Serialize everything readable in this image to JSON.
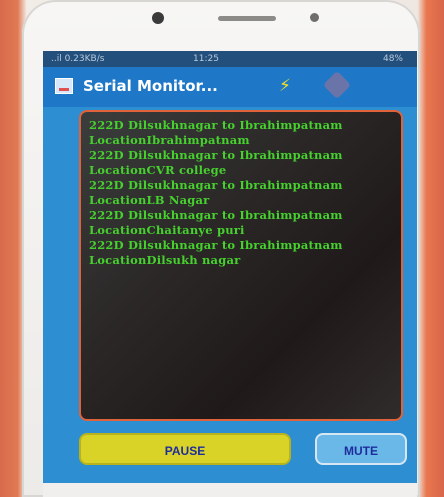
{
  "status_bar": {
    "left_text": "..il 0.23KB/s",
    "time": "11:25",
    "right_text": "48%"
  },
  "app": {
    "title": "Serial Monitor...",
    "icon": "serial-monitor-icon",
    "actions": [
      {
        "name": "bolt-icon"
      },
      {
        "name": "connection-icon"
      }
    ]
  },
  "log": {
    "entries": [
      {
        "route": "222D Dilsukhnagar to Ibrahimpatnam",
        "location": "LocationIbrahimpatnam"
      },
      {
        "route": "222D Dilsukhnagar to Ibrahimpatnam",
        "location": "LocationCVR college"
      },
      {
        "route": "222D Dilsukhnagar to Ibrahimpatnam",
        "location": "LocationLB Nagar"
      },
      {
        "route": "222D Dilsukhnagar to Ibrahimpatnam",
        "location": "LocationChaitanye puri"
      },
      {
        "route": "222D Dilsukhnagar to Ibrahimpatnam",
        "location": "LocationDilsukh nagar"
      }
    ]
  },
  "buttons": {
    "pause_label": "PAUSE",
    "mute_label": "MUTE"
  },
  "colors": {
    "screen_bg": "#2d8ed2",
    "log_text": "#46d12e",
    "pause_bg": "#d9d328",
    "mute_bg": "#69b8e8"
  }
}
